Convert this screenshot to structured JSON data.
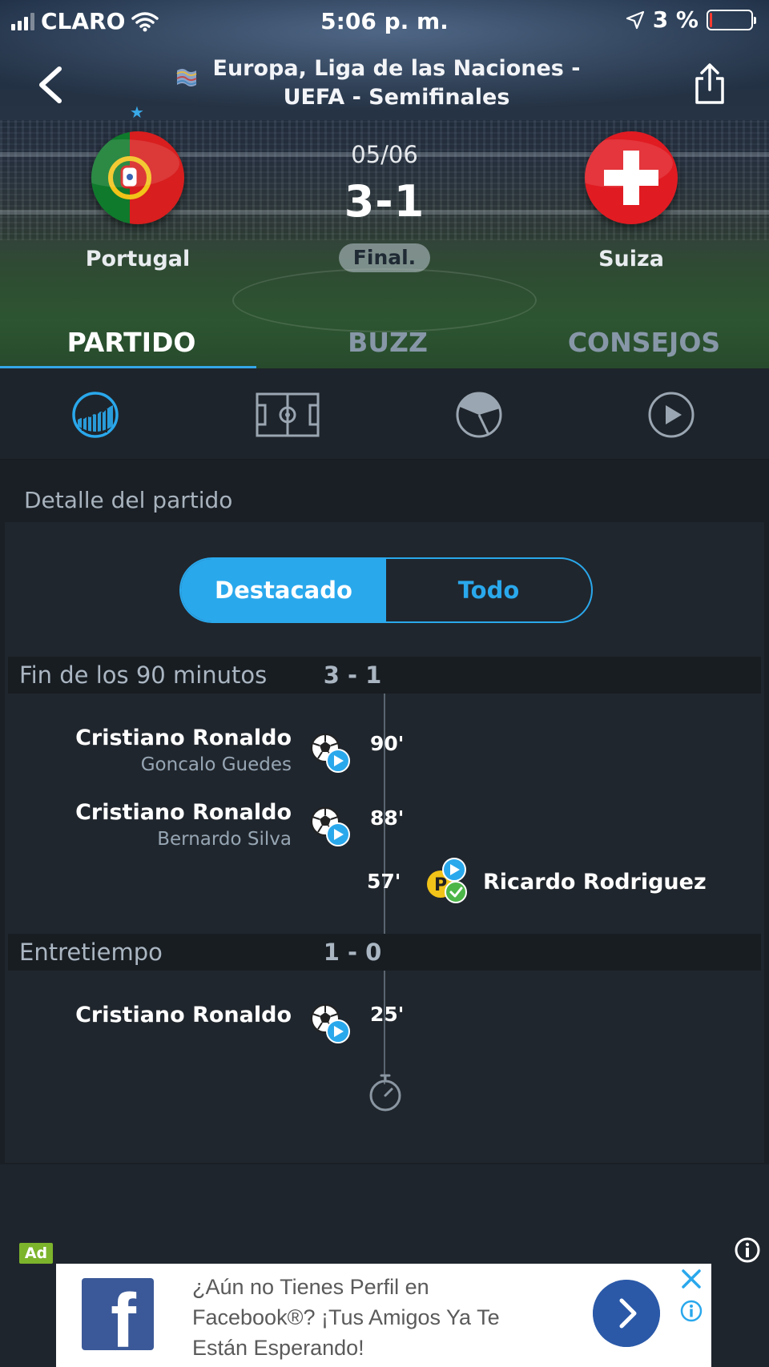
{
  "status_bar": {
    "carrier": "CLARO",
    "time": "5:06 p. m.",
    "battery": "3 %"
  },
  "header": {
    "competition_title": "Europa, Liga de las Naciones - UEFA - Semifinales",
    "home_team": "Portugal",
    "away_team": "Suiza",
    "date": "05/06",
    "score": "3-1",
    "status": "Final."
  },
  "tabs": [
    {
      "label": "PARTIDO",
      "active": true
    },
    {
      "label": "BUZZ",
      "active": false
    },
    {
      "label": "CONSEJOS",
      "active": false
    }
  ],
  "subnav": {
    "icons": [
      "stats-chart-icon",
      "pitch-lineup-icon",
      "pie-chart-icon",
      "play-video-icon"
    ]
  },
  "detail": {
    "section_title": "Detalle del partido",
    "toggle": {
      "highlighted": "Destacado",
      "all": "Todo",
      "selected": "Destacado"
    },
    "periods": [
      {
        "label": "Fin de los 90 minutos",
        "score": "3 - 1",
        "events": [
          {
            "player": "Cristiano Ronaldo",
            "assist": "Goncalo Guedes",
            "minute": "90'",
            "type": "goal",
            "side": "home"
          },
          {
            "player": "Cristiano Ronaldo",
            "assist": "Bernardo Silva",
            "minute": "88'",
            "type": "goal",
            "side": "home"
          },
          {
            "player": "Ricardo Rodriguez",
            "assist": "",
            "minute": "57'",
            "type": "penalty-goal",
            "side": "away",
            "penalty_letter": "P"
          }
        ]
      },
      {
        "label": "Entretiempo",
        "score": "1 - 0",
        "events": [
          {
            "player": "Cristiano Ronaldo",
            "assist": "",
            "minute": "25'",
            "type": "goal",
            "side": "home"
          }
        ]
      }
    ]
  },
  "ad": {
    "badge": "Ad",
    "text": "¿Aún no Tienes Perfil en Facebook®? ¡Tus Amigos Ya Te Están Esperando!",
    "brand_letter": "f"
  },
  "colors": {
    "accent": "#2aa8ec",
    "background": "#1f252d",
    "facebook_blue": "#3b5998",
    "ad_badge": "#7cb42c"
  }
}
